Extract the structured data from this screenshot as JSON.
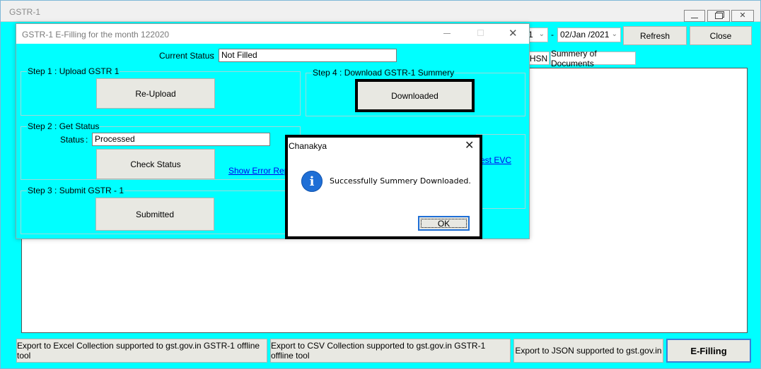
{
  "main_window": {
    "title": "GSTR-1",
    "to_date": "02/Jan /2021",
    "from_date_fragment": "1",
    "date_separator": "-",
    "refresh_label": "Refresh",
    "close_label": "Close",
    "tabs": [
      {
        "label": "HSN"
      },
      {
        "label": "Summery of Documents"
      }
    ],
    "bottom_buttons": {
      "export_excel": "Export to Excel Collection supported to gst.gov.in GSTR-1 offline tool",
      "export_csv": "Export to CSV Collection supported to gst.gov.in GSTR-1 offline tool",
      "export_json": "Export to JSON supported to gst.gov.in",
      "efilling": "E-Filling"
    }
  },
  "efiling_dialog": {
    "title": "GSTR-1 E-Filling for the month 122020",
    "current_status_label": "Current Status",
    "colon": ":",
    "current_status_value": "Not Filled",
    "step1": {
      "title": "Step 1 : Upload GSTR 1",
      "button": "Re-Upload"
    },
    "step2": {
      "title": "Step 2 : Get Status",
      "status_label": "Status",
      "status_value": "Processed",
      "button": "Check Status",
      "error_link": "Show Error Report"
    },
    "step3": {
      "title": "Step 3 : Submit GSTR - 1",
      "button": "Submitted"
    },
    "step4": {
      "title": "Step 4 : Download GSTR-1 Summery",
      "button": "Downloaded"
    },
    "evc_link_fragment": "est EVC"
  },
  "message_box": {
    "title": "Chanakya",
    "message": "Successfully Summery Downloaded.",
    "ok_label": "OK",
    "icon": "info-icon"
  },
  "colors": {
    "dialog_bg": "#00ffff",
    "info_blue": "#1f6fd6",
    "link_blue": "#0000ee"
  }
}
